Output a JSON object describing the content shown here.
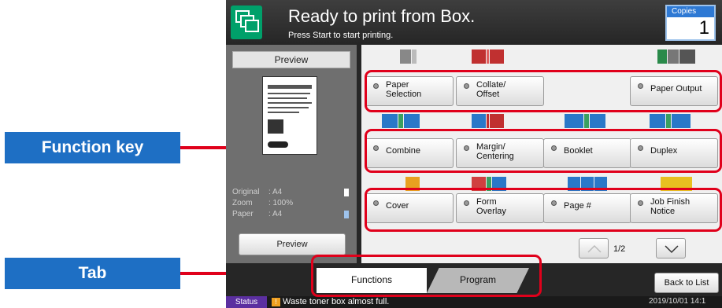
{
  "callouts": {
    "function_key": "Function key",
    "tab": "Tab"
  },
  "header": {
    "title": "Ready to print from Box.",
    "subtitle": "Press Start to start printing."
  },
  "copies": {
    "label": "Copies",
    "value": "1"
  },
  "preview": {
    "title": "Preview",
    "original_label": "Original",
    "original_value": ": A4",
    "zoom_label": "Zoom",
    "zoom_value": ": 100%",
    "paper_label": "Paper",
    "paper_value": ": A4",
    "button": "Preview"
  },
  "function_keys": [
    {
      "label": "Paper\nSelection"
    },
    {
      "label": "Collate/\nOffset"
    },
    {
      "label": "Paper Output"
    },
    {
      "label": "Combine"
    },
    {
      "label": "Margin/\nCentering"
    },
    {
      "label": "Booklet"
    },
    {
      "label": "Duplex"
    },
    {
      "label": "Cover"
    },
    {
      "label": "Form\nOverlay"
    },
    {
      "label": "Page #"
    },
    {
      "label": "Job Finish\nNotice"
    }
  ],
  "pager": {
    "indicator": "1/2"
  },
  "tabs": {
    "functions": "Functions",
    "program": "Program"
  },
  "back_to_list": "Back to List",
  "status": {
    "label": "Status",
    "message": "Waste toner box almost full.",
    "datetime": "2019/10/01  14:1"
  },
  "colors": {
    "accent_blue": "#1e6fc4",
    "highlight_red": "#e0001b",
    "box_green": "#00a06a"
  }
}
